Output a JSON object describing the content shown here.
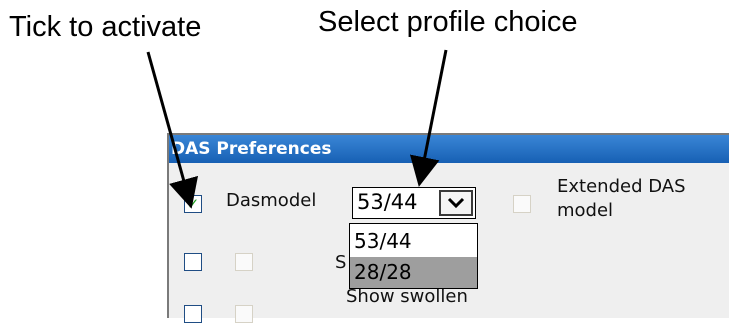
{
  "annotations": {
    "tick": "Tick to activate",
    "select": "Select profile choice"
  },
  "panel": {
    "title": "DAS Preferences",
    "dasmodel": {
      "label": "Dasmodel",
      "checked": true
    },
    "profile_select": {
      "value": "53/44",
      "options": [
        "53/44",
        "28/28"
      ],
      "highlighted_option": "28/28"
    },
    "extended": {
      "label_line1": "Extended DAS",
      "label_line2": "model"
    },
    "partial_label": "S",
    "show_swollen": "Show swollen"
  },
  "icons": {
    "check": "checkmark-icon",
    "dropdown": "chevron-down-icon"
  },
  "colors": {
    "header": "#1b66bb",
    "check": "#21a121",
    "highlight": "#9e9e9e"
  }
}
